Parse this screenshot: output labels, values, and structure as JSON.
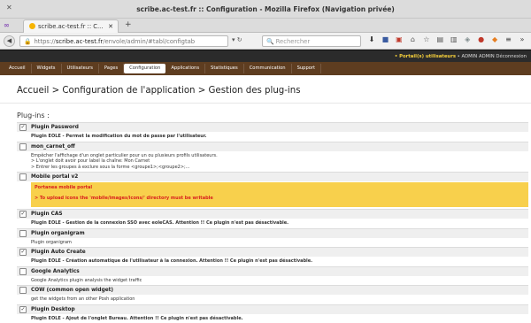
{
  "window": {
    "title": "scribe.ac-test.fr :: Configuration - Mozilla Firefox (Navigation privée)"
  },
  "tab": {
    "label": "scribe.ac-test.fr :: C..."
  },
  "url": {
    "prefix": "https://",
    "host": "scribe.ac-test.fr",
    "path": "/envole/admin/#tabl/configtab"
  },
  "search": {
    "placeholder": "Rechercher"
  },
  "appmenu": {
    "portal": "• Portail(s) utilisateurs",
    "admin": " • ADMIN ADMIN  Déconnexion"
  },
  "mainmenu": [
    {
      "label": "Accueil",
      "active": false
    },
    {
      "label": "Widgets",
      "active": false
    },
    {
      "label": "Utilisateurs",
      "active": false
    },
    {
      "label": "Pages",
      "active": false
    },
    {
      "label": "Configuration",
      "active": true
    },
    {
      "label": "Applications",
      "active": false
    },
    {
      "label": "Statistiques",
      "active": false
    },
    {
      "label": "Communication",
      "active": false
    },
    {
      "label": "Support",
      "active": false
    }
  ],
  "breadcrumb": "Accueil > Configuration de l'application > Gestion des plug-ins",
  "section_title": "Plug-ins :",
  "plugins": [
    {
      "name": "Plugin Password",
      "checked": true,
      "desc": [
        "Plugin EOLE - Permet la modification du mot de passe par l'utilisateur."
      ],
      "desc_bold": true
    },
    {
      "name": "mon_carnet_off",
      "checked": false,
      "desc": [
        "Empêcher l'affichage d'un onglet particulier pour un ou plusieurs profils utilisateurs.",
        "> L'onglet doit avoir pour label la chaîne: Mon Carnet",
        "> Entrer les groupes à exclure sous la forme <groupe1>;<groupe2>;..."
      ],
      "desc_bold": false
    },
    {
      "name": "Mobile portal v2",
      "checked": false,
      "warn": [
        "Portanea mobile portal",
        "> To upload icons the 'mobile/images/icons/' directory must be writable"
      ]
    },
    {
      "name": "Plugin CAS",
      "checked": true,
      "desc": [
        "Plugin EOLE - Gestion de la connexion SSO avec eoleCAS. Attention !! Ce plugin n'est pas désactivable."
      ],
      "desc_bold": true
    },
    {
      "name": "Plugin organigram",
      "checked": false,
      "desc": [
        "Plugin organigram"
      ],
      "desc_bold": false
    },
    {
      "name": "Plugin Auto Create",
      "checked": true,
      "desc": [
        "Plugin EOLE - Création automatique de l'utilisateur à la connexion. Attention !! Ce plugin n'est pas désactivable."
      ],
      "desc_bold": true
    },
    {
      "name": "Google Analytics",
      "checked": false,
      "desc": [
        "Google Analytics plugin analysis the widget traffic"
      ],
      "desc_bold": false
    },
    {
      "name": "COW (common open widget)",
      "checked": false,
      "desc": [
        "get the widgets from an other Posh application"
      ],
      "desc_bold": false
    },
    {
      "name": "Plugin Desktop",
      "checked": true,
      "desc": [
        "Plugin EOLE - Ajout de l'onglet Bureau. Attention !! Ce plugin n'est pas désactivable."
      ],
      "desc_bold": true
    }
  ]
}
